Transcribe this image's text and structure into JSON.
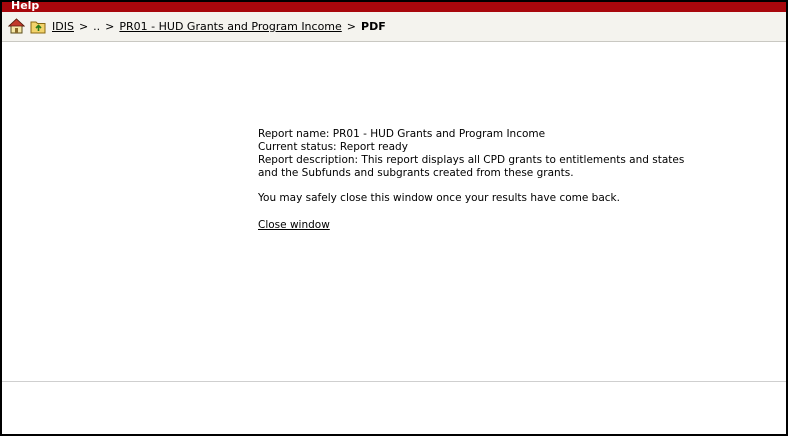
{
  "header": {
    "help_label": "Help"
  },
  "breadcrumb": {
    "home_icon": "home-icon",
    "folder_icon": "folder-up-icon",
    "items": [
      {
        "label": "IDIS",
        "link": true
      },
      {
        "label": "..",
        "link": false
      },
      {
        "label": "PR01 - HUD Grants and Program Income",
        "link": true
      },
      {
        "label": "PDF",
        "link": false,
        "current": true
      }
    ],
    "separator": ">"
  },
  "report": {
    "name_line": "Report name: PR01 - HUD Grants and Program Income",
    "status_line": "Current status: Report ready",
    "description_line1": "Report description: This report displays all CPD grants to entitlements and states",
    "description_line2": "and the Subfunds and subgrants created from these grants.",
    "close_note": "You may safely close this window once your results have come back.",
    "close_link": "Close window"
  },
  "colors": {
    "top_bar": "#a8070c",
    "crumb_bar": "#f4f3ee"
  }
}
